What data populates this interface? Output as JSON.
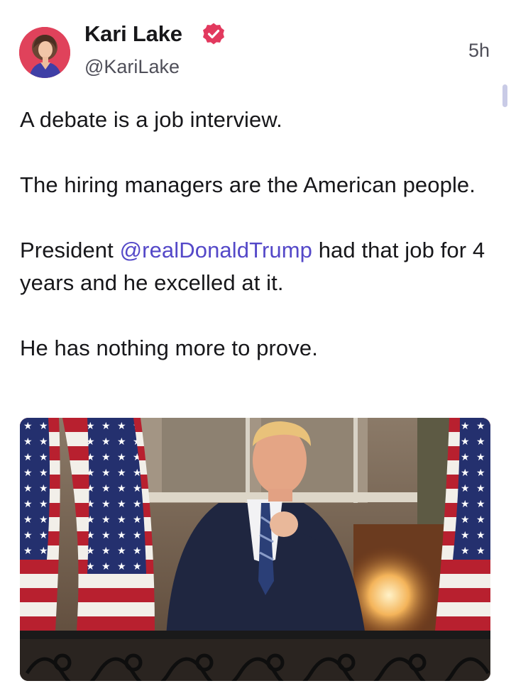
{
  "post": {
    "author": {
      "display_name": "Kari Lake",
      "handle": "@KariLake",
      "verified": true,
      "verified_icon": "verified-badge-icon"
    },
    "timestamp": "5h",
    "body": {
      "p1": "A debate is a job interview.",
      "p2": "The hiring managers are the American people.",
      "p3_before": "President ",
      "p3_mention": "@realDonaldTrump",
      "p3_after": " had that job for 4 years and he excelled at it.",
      "p4": "He has nothing more to prove."
    },
    "media": {
      "type": "photo"
    }
  },
  "colors": {
    "text": "#17171a",
    "secondary_text": "#4f4f59",
    "mention": "#5448c8",
    "verified_badge": "#e2395e",
    "scrollbar": "#c9cbe6"
  }
}
